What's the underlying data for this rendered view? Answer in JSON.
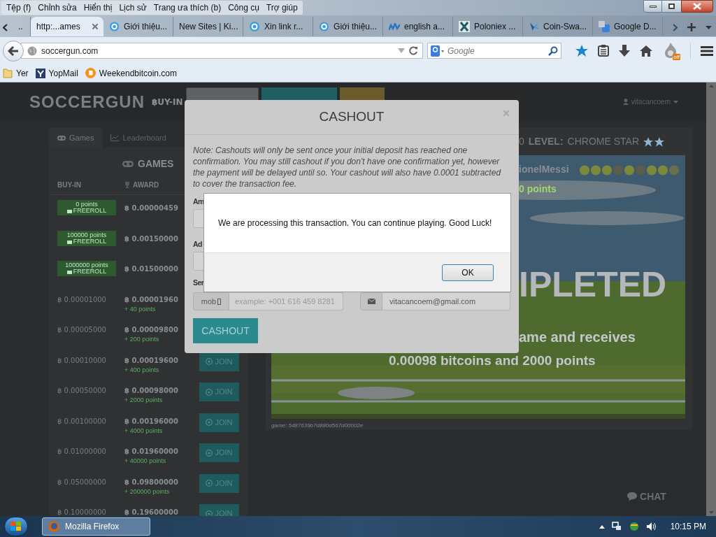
{
  "menu_bar": [
    "Tệp (f)",
    "Chỉnh sửa",
    "Hiển thị",
    "Lịch sử",
    "Trang ưa thích (b)",
    "Công cụ",
    "Trợ giúp"
  ],
  "tabs": [
    {
      "label": "..",
      "selected": false
    },
    {
      "label": "http:...ames",
      "selected": true
    },
    {
      "label": "Giới thiệu...",
      "selected": false
    },
    {
      "label": "New Sites | Ki...",
      "selected": false
    },
    {
      "label": "Xin link r...",
      "selected": false
    },
    {
      "label": "Giới thiệu...",
      "selected": false
    },
    {
      "label": "english a...",
      "selected": false
    },
    {
      "label": "Poloniex ...",
      "selected": false
    },
    {
      "label": "Coin-Swa...",
      "selected": false
    },
    {
      "label": "Google D...",
      "selected": false
    }
  ],
  "address": {
    "url": "soccergun.com"
  },
  "search": {
    "placeholder": "Google"
  },
  "extension_badge": "off",
  "bookmarks": [
    {
      "label": "Yer"
    },
    {
      "label": "YopMail"
    },
    {
      "label": "Weekendbitcoin.com"
    }
  ],
  "site": {
    "logo": "SOCCERGUN",
    "buyin_label": "฿UY-IN",
    "user": "vitacancoem"
  },
  "left_tabs": [
    {
      "label": "Games",
      "selected": true
    },
    {
      "label": "Leaderboard",
      "selected": false
    }
  ],
  "games": {
    "title": "GAMES",
    "columns": [
      "BUY-IN",
      "AWARD"
    ],
    "rows": [
      {
        "kind": "freeroll",
        "points": "0 points",
        "badge": "FREEROLL",
        "award": "฿ 0.00000459"
      },
      {
        "kind": "freeroll",
        "points": "100000 points",
        "badge": "FREEROLL",
        "award": "฿ 0.00150000"
      },
      {
        "kind": "freeroll",
        "points": "1000000 points",
        "badge": "FREEROLL",
        "award": "฿ 0.01500000"
      },
      {
        "kind": "paid",
        "buy_in": "฿ 0.00001000",
        "award": "฿ 0.00001960",
        "bonus": "+ 40 points"
      },
      {
        "kind": "paid",
        "buy_in": "฿ 0.00005000",
        "award": "฿ 0.00009800",
        "bonus": "+ 200 points"
      },
      {
        "kind": "paid",
        "buy_in": "฿ 0.00010000",
        "award": "฿ 0.00019600",
        "bonus": "+ 400 points",
        "button": "JOIN"
      },
      {
        "kind": "paid",
        "buy_in": "฿ 0.00050000",
        "award": "฿ 0.00098000",
        "bonus": "+ 2000 points",
        "button": "JOIN"
      },
      {
        "kind": "paid",
        "buy_in": "฿ 0.00100000",
        "award": "฿ 0.00196000",
        "bonus": "+ 4000 points",
        "button": "JOIN"
      },
      {
        "kind": "paid",
        "buy_in": "฿ 0.01000000",
        "award": "฿ 0.01960000",
        "bonus": "+ 40000 points",
        "button": "JOIN"
      },
      {
        "kind": "paid",
        "buy_in": "฿ 0.05000000",
        "award": "฿ 0.09800000",
        "bonus": "+ 200000 points",
        "button": "JOIN"
      },
      {
        "kind": "paid",
        "buy_in": "฿ 0.10000000",
        "award": "฿ 0.19600000",
        "button": "JOIN"
      }
    ]
  },
  "level": {
    "prefix": "0",
    "label": "LEVEL:",
    "value": "CHROME STAR"
  },
  "game": {
    "player": "ionelMessi",
    "points": "0 points",
    "status": "IPLETED",
    "message_1": "ame and receives",
    "message_2": "0.00098 bitcoins and 2000 points",
    "game_id": "game: 5487639b7d880d567d00002e"
  },
  "chat": "CHAT",
  "modal": {
    "title": "CASHOUT",
    "note": "Note: Cashouts will only be sent once your initial deposit has reached one confirmation. You may still cashout if you don't have one confirmation yet, however the payment will be delayed until so. Your cashout will also have 0.0001 subtracted to cover the transaction fee.",
    "labels": [
      "Am",
      "Ad",
      "Ser"
    ],
    "phone_addon": "mob",
    "phone_placeholder": "example: +001 616 459 8281",
    "email": "vitacancoem@gmail.com",
    "button": "CASHOUT"
  },
  "alert": {
    "message": "We are processing this transaction. You can continue playing. Good Luck!",
    "button": "OK"
  },
  "taskbar": {
    "apps": [
      {
        "label": "Mozilla Firefox",
        "selected": true
      }
    ],
    "clock": "10:15 PM"
  }
}
